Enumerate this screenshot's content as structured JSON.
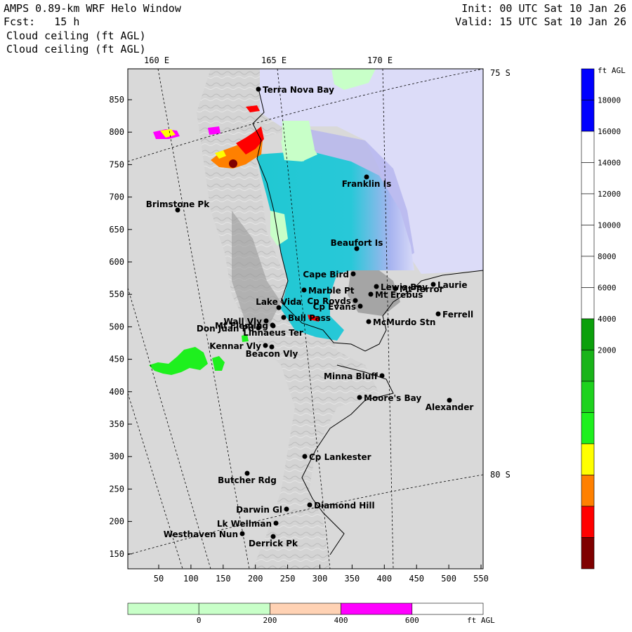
{
  "header": {
    "title": "AMPS 0.89-km WRF Helo Window",
    "forecast": "Fcst:   15 h",
    "field_line_1": "Cloud ceiling (ft AGL)",
    "field_line_2": "Cloud ceiling (ft AGL)",
    "init": "Init: 00 UTC Sat 10 Jan 26",
    "valid": "Valid: 15 UTC Sat 10 Jan 26"
  },
  "map": {
    "lon_labels": [
      "160 E",
      "165 E",
      "170 E"
    ],
    "lat_labels": [
      "75 S",
      "80 S"
    ],
    "y_ticks": [
      "850",
      "800",
      "750",
      "700",
      "650",
      "600",
      "550",
      "500",
      "450",
      "400",
      "350",
      "300",
      "250",
      "200",
      "150"
    ],
    "x_ticks": [
      "50",
      "100",
      "150",
      "200",
      "250",
      "300",
      "350",
      "400",
      "450",
      "500",
      "550"
    ],
    "stations": [
      {
        "name": "Terra Nova Bay"
      },
      {
        "name": "Franklin Is"
      },
      {
        "name": "Brimstone Pk"
      },
      {
        "name": "Beaufort Is"
      },
      {
        "name": "Cape Bird"
      },
      {
        "name": "Lewis Bay"
      },
      {
        "name": "Laurie"
      },
      {
        "name": "Mt Terror"
      },
      {
        "name": "Marble Pt"
      },
      {
        "name": "Cp Royds"
      },
      {
        "name": "Mt Erebus"
      },
      {
        "name": "Lake Vida"
      },
      {
        "name": "Cp Evans"
      },
      {
        "name": "Ferrell"
      },
      {
        "name": "Wall Vly"
      },
      {
        "name": "Bull Pass"
      },
      {
        "name": "McMurdo Stn"
      },
      {
        "name": "Don Juan Pd"
      },
      {
        "name": "Mt Fleming"
      },
      {
        "name": "Linnaeus Ter"
      },
      {
        "name": "Kennar Vly"
      },
      {
        "name": "Beacon Vly"
      },
      {
        "name": "Minna Bluff"
      },
      {
        "name": "Moore's Bay"
      },
      {
        "name": "Alexander"
      },
      {
        "name": "Cp Lankester"
      },
      {
        "name": "Butcher Rdg"
      },
      {
        "name": "Diamond Hill"
      },
      {
        "name": "Darwin Gl"
      },
      {
        "name": "Lk Wellman"
      },
      {
        "name": "Westhaven Nun"
      },
      {
        "name": "Derrick Pk"
      }
    ]
  },
  "colorbar": {
    "unit": "ft AGL",
    "labels": [
      "18000",
      "16000",
      "14000",
      "12000",
      "10000",
      "8000",
      "6000",
      "4000",
      "2000"
    ],
    "colors": [
      "#0000ff",
      "#0000ff",
      "#ffffff",
      "#ffffff",
      "#ffffff",
      "#ffffff",
      "#ffffff",
      "#ffffff",
      "#0ca00c",
      "#19b419",
      "#1ed21e",
      "#1ef01e",
      "#ffff00",
      "#ff8000",
      "#ff0000",
      "#7f0000"
    ]
  },
  "bottom_bar": {
    "labels": [
      "0",
      "200",
      "400",
      "600"
    ],
    "unit": "ft AGL",
    "colors": [
      "#c8ffc8",
      "#c8ffc8",
      "#ffd2b4",
      "#ff00ff",
      "#ffffff"
    ]
  }
}
